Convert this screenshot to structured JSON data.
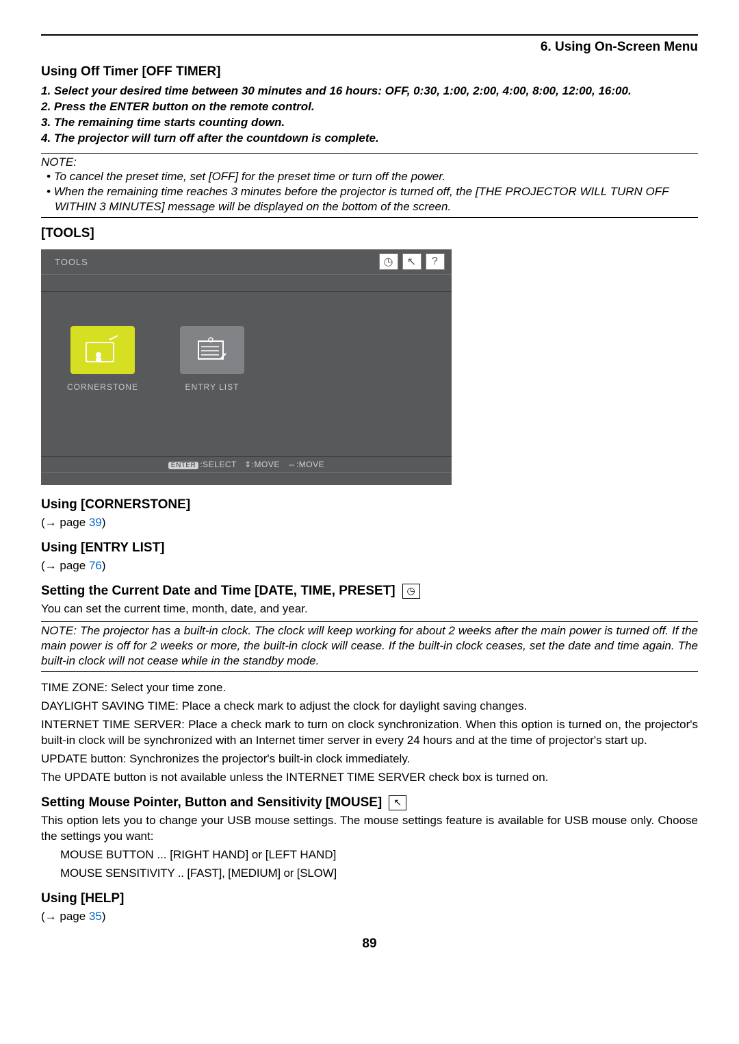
{
  "chapter": "6. Using On-Screen Menu",
  "off_timer": {
    "title": "Using Off Timer [OFF TIMER]",
    "steps": [
      "Select your desired time between 30 minutes and 16 hours: OFF, 0:30, 1:00, 2:00, 4:00, 8:00, 12:00, 16:00.",
      "Press the ENTER button on the remote control.",
      "The remaining time starts counting down.",
      "The projector will turn off after the countdown is complete."
    ],
    "note_label": "NOTE:",
    "notes": [
      "To cancel the preset time, set [OFF] for the preset time or turn off the power.",
      "When the remaining time reaches 3 minutes before the projector is turned off, the [THE PROJECTOR WILL TURN OFF WITHIN 3 MINUTES] message will be displayed on the bottom of the screen."
    ]
  },
  "tools": {
    "heading": "[TOOLS]",
    "panel": {
      "title": "TOOLS",
      "icon_clock": "◷",
      "icon_mouse": "↖",
      "icon_help": "?",
      "items": [
        {
          "label": "CORNERSTONE",
          "selected": true
        },
        {
          "label": "ENTRY LIST",
          "selected": false
        }
      ],
      "hint_enter": "ENTER",
      "hint_select": ":SELECT",
      "hint_move1": "⇕:MOVE",
      "hint_move2": "⇔:MOVE"
    }
  },
  "cornerstone": {
    "title": "Using [CORNERSTONE]",
    "ref_prefix": "(→ page ",
    "ref_page": "39",
    "ref_suffix": ")"
  },
  "entry_list": {
    "title": "Using [ENTRY LIST]",
    "ref_prefix": "(→ page ",
    "ref_page": "76",
    "ref_suffix": ")"
  },
  "datetime": {
    "title": "Setting the Current Date and Time [DATE, TIME, PRESET]",
    "icon": "◷",
    "intro": "You can set the current time, month, date, and year.",
    "note": "NOTE: The projector has a built-in clock. The clock will keep working for about 2 weeks after the main power is turned off. If the main power is off for 2 weeks or more, the built-in clock will cease. If the built-in clock ceases, set the date and time again. The built-in clock will not cease while in the standby mode.",
    "lines": [
      "TIME ZONE: Select your time zone.",
      "DAYLIGHT SAVING TIME: Place a check mark to adjust the clock for daylight saving changes.",
      "INTERNET TIME SERVER: Place a check mark to turn on clock synchronization. When this option is turned on, the projector's built-in clock will be synchronized with an Internet timer server in every 24 hours and at the time of projector's start up.",
      "UPDATE button: Synchronizes the projector's built-in clock immediately.",
      "The UPDATE button is not available unless the INTERNET TIME SERVER check box is turned on."
    ]
  },
  "mouse": {
    "title": "Setting Mouse Pointer, Button and Sensitivity [MOUSE]",
    "icon": "↖",
    "intro": "This option lets you to change your USB mouse settings. The mouse settings feature is available for USB mouse only. Choose the settings you want:",
    "lines": [
      "MOUSE BUTTON ... [RIGHT HAND] or [LEFT HAND]",
      "MOUSE SENSITIVITY .. [FAST], [MEDIUM] or [SLOW]"
    ]
  },
  "help": {
    "title": "Using [HELP]",
    "ref_prefix": "(→ page ",
    "ref_page": "35",
    "ref_suffix": ")"
  },
  "page_number": "89"
}
